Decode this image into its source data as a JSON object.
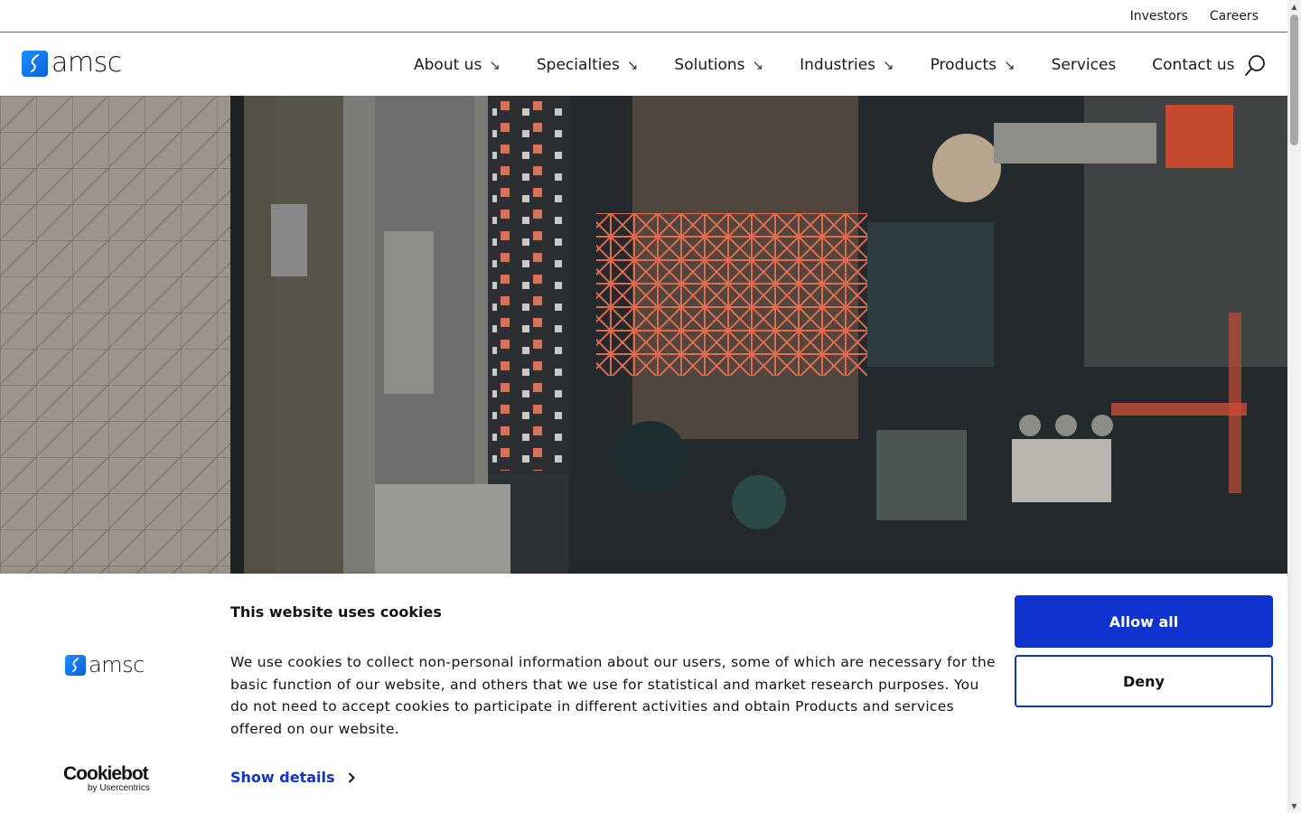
{
  "utility_nav": {
    "investors": "Investors",
    "careers": "Careers"
  },
  "header": {
    "logo_text": "amsc",
    "nav": [
      {
        "label": "About us",
        "has_submenu": true
      },
      {
        "label": "Specialties",
        "has_submenu": true
      },
      {
        "label": "Solutions",
        "has_submenu": true
      },
      {
        "label": "Industries",
        "has_submenu": true
      },
      {
        "label": "Products",
        "has_submenu": true
      },
      {
        "label": "Services",
        "has_submenu": false
      },
      {
        "label": "Contact us",
        "has_submenu": false
      }
    ],
    "submenu_arrow": "↘"
  },
  "cookie_banner": {
    "logo_text": "amsc",
    "title": "This website uses cookies",
    "body": "We use cookies to collect non-personal information about our users, some of which are necessary for the basic function of our website, and others that we use for statistical and market research purposes.  You do not need to accept cookies to participate in different activities and obtain Products and services offered on our website.",
    "show_details": "Show details",
    "allow_all": "Allow all",
    "deny": "Deny",
    "provider_brand": "Cookiebot",
    "provider_sub": "by Usercentrics"
  },
  "colors": {
    "accent_blue": "#1032cf",
    "brand_blue": "#1e90ff",
    "divider": "#2b7fb0"
  }
}
